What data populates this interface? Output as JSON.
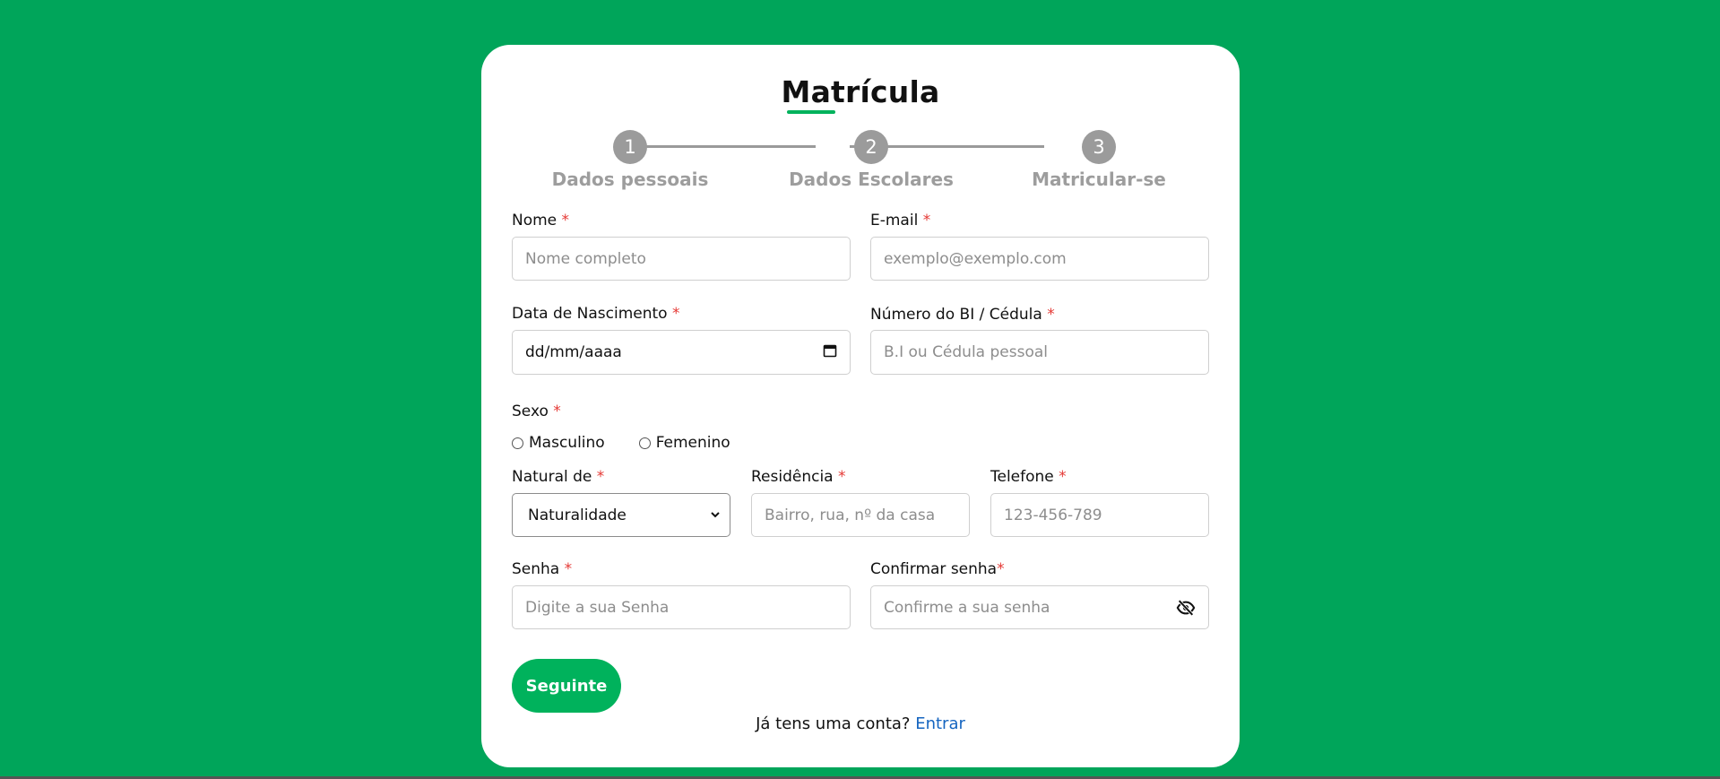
{
  "form": {
    "title": "Matrícula",
    "steps": [
      {
        "number": "1",
        "label": "Dados pessoais"
      },
      {
        "number": "2",
        "label": "Dados Escolares"
      },
      {
        "number": "3",
        "label": "Matricular-se"
      }
    ],
    "required_mark": "*",
    "nome": {
      "label": "Nome",
      "placeholder": "Nome completo"
    },
    "email": {
      "label": "E-mail",
      "placeholder": "exemplo@exemplo.com"
    },
    "nascimento": {
      "label": "Data de Nascimento",
      "value": "dd/mm/aaaa"
    },
    "bi": {
      "label": "Número do BI / Cédula",
      "placeholder": "B.I ou Cédula pessoal"
    },
    "sexo": {
      "label": "Sexo",
      "options": [
        "Masculino",
        "Femenino"
      ]
    },
    "natural": {
      "label": "Natural de",
      "selected": "Naturalidade"
    },
    "residencia": {
      "label": "Residência",
      "placeholder": "Bairro, rua, nº da casa"
    },
    "telefone": {
      "label": "Telefone",
      "placeholder": "123-456-789"
    },
    "senha": {
      "label": "Senha",
      "placeholder": "Digite a sua Senha"
    },
    "confirmar": {
      "label": "Confirmar senha",
      "placeholder": "Confirme a sua senha"
    },
    "next_button": "Seguinte",
    "footer_text": "Já tens uma conta?",
    "footer_link": "Entrar"
  },
  "colors": {
    "background": "#00a55a",
    "accent": "#00b25c",
    "required": "#e53935",
    "link": "#1565c0"
  },
  "icons": {
    "password_toggle": "eye-off-icon",
    "calendar": "calendar-icon",
    "dropdown": "chevron-down-icon"
  }
}
